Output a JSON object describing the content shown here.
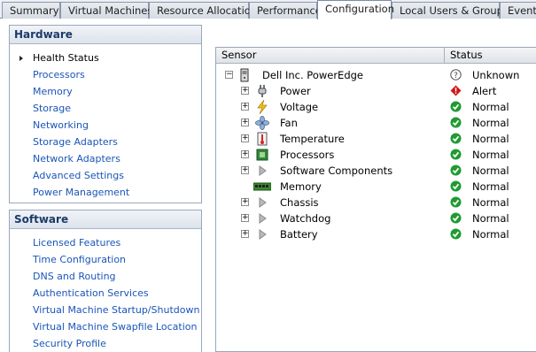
{
  "tabs": [
    {
      "label": "Summary"
    },
    {
      "label": "Virtual Machines"
    },
    {
      "label": "Resource Allocation"
    },
    {
      "label": "Performance"
    },
    {
      "label": "Configuration",
      "active": true
    },
    {
      "label": "Local Users & Groups"
    },
    {
      "label": "Events"
    }
  ],
  "hardware": {
    "title": "Hardware",
    "items": [
      {
        "label": "Health Status",
        "current": true
      },
      {
        "label": "Processors"
      },
      {
        "label": "Memory"
      },
      {
        "label": "Storage"
      },
      {
        "label": "Networking"
      },
      {
        "label": "Storage Adapters"
      },
      {
        "label": "Network Adapters"
      },
      {
        "label": "Advanced Settings"
      },
      {
        "label": "Power Management"
      }
    ]
  },
  "software": {
    "title": "Software",
    "items": [
      {
        "label": "Licensed Features"
      },
      {
        "label": "Time Configuration"
      },
      {
        "label": "DNS and Routing"
      },
      {
        "label": "Authentication Services"
      },
      {
        "label": "Virtual Machine Startup/Shutdown"
      },
      {
        "label": "Virtual Machine Swapfile Location"
      },
      {
        "label": "Security Profile"
      }
    ]
  },
  "grid": {
    "columns": {
      "sensor": "Sensor",
      "status": "Status"
    },
    "rows": [
      {
        "name": "Dell Inc. PowerEdge",
        "icon": "server-icon",
        "status": "Unknown",
        "status_icon": "unknown-icon",
        "level": 0,
        "expander": "minus"
      },
      {
        "name": "Power",
        "icon": "power-plug-icon",
        "status": "Alert",
        "status_icon": "alert-icon",
        "level": 1,
        "expander": "plus"
      },
      {
        "name": "Voltage",
        "icon": "lightning-icon",
        "status": "Normal",
        "status_icon": "normal-check-icon",
        "level": 1,
        "expander": "plus"
      },
      {
        "name": "Fan",
        "icon": "fan-icon",
        "status": "Normal",
        "status_icon": "normal-check-icon",
        "level": 1,
        "expander": "plus"
      },
      {
        "name": "Temperature",
        "icon": "thermometer-icon",
        "status": "Normal",
        "status_icon": "normal-check-icon",
        "level": 1,
        "expander": "plus"
      },
      {
        "name": "Processors",
        "icon": "processor-icon",
        "status": "Normal",
        "status_icon": "normal-check-icon",
        "level": 1,
        "expander": "plus"
      },
      {
        "name": "Software Components",
        "icon": "triangle-icon",
        "status": "Normal",
        "status_icon": "normal-check-icon",
        "level": 1,
        "expander": "plus"
      },
      {
        "name": "Memory",
        "icon": "memory-module-icon",
        "status": "Normal",
        "status_icon": "normal-check-icon",
        "level": 1,
        "expander": "none"
      },
      {
        "name": "Chassis",
        "icon": "triangle-icon",
        "status": "Normal",
        "status_icon": "normal-check-icon",
        "level": 1,
        "expander": "plus"
      },
      {
        "name": "Watchdog",
        "icon": "triangle-icon",
        "status": "Normal",
        "status_icon": "normal-check-icon",
        "level": 1,
        "expander": "plus"
      },
      {
        "name": "Battery",
        "icon": "triangle-icon",
        "status": "Normal",
        "status_icon": "normal-check-icon",
        "level": 1,
        "expander": "plus"
      }
    ]
  },
  "colors": {
    "link": "#1a55b8",
    "header_text": "#1c3a69",
    "normal": "#1e9c2e",
    "alert": "#d01818"
  }
}
